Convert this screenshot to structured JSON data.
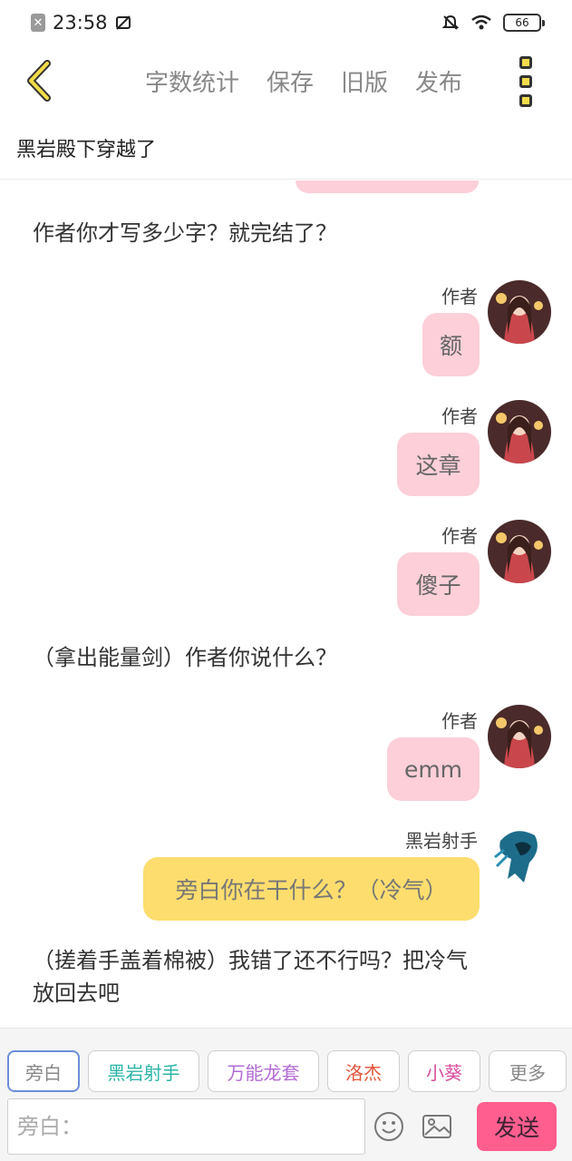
{
  "status_bar": {
    "time": "23:58",
    "battery": "66"
  },
  "nav": {
    "links": [
      "字数统计",
      "保存",
      "旧版",
      "发布"
    ]
  },
  "document_title": "黑岩殿下穿越了",
  "chat": {
    "narration_1": "作者你才写多少字？就完结了？",
    "msg_1": {
      "speaker": "作者",
      "text": "额"
    },
    "msg_2": {
      "speaker": "作者",
      "text": "这章"
    },
    "msg_3": {
      "speaker": "作者",
      "text": "傻子"
    },
    "narration_2": "（拿出能量剑）作者你说什么？",
    "msg_4": {
      "speaker": "作者",
      "text": "emm"
    },
    "msg_5": {
      "speaker": "黑岩射手",
      "text": "旁白你在干什么？（冷气）"
    },
    "narration_3_line1": "（搓着手盖着棉被）我错了还不行吗？把冷气",
    "narration_3_line2": "放回去吧"
  },
  "characters": [
    {
      "label": "旁白",
      "color": "#888888"
    },
    {
      "label": "黑岩射手",
      "color": "#2bb5a6"
    },
    {
      "label": "万能龙套",
      "color": "#b36ad4"
    },
    {
      "label": "洛杰",
      "color": "#e2553b"
    },
    {
      "label": "小葵",
      "color": "#d94da0"
    },
    {
      "label": "更多",
      "color": "#888888"
    }
  ],
  "input": {
    "placeholder": "旁白：",
    "send_label": "发送"
  },
  "colors": {
    "pink_bubble": "#fccfd9",
    "yellow_bubble": "#fddd6e",
    "send": "#ff5e8f"
  }
}
